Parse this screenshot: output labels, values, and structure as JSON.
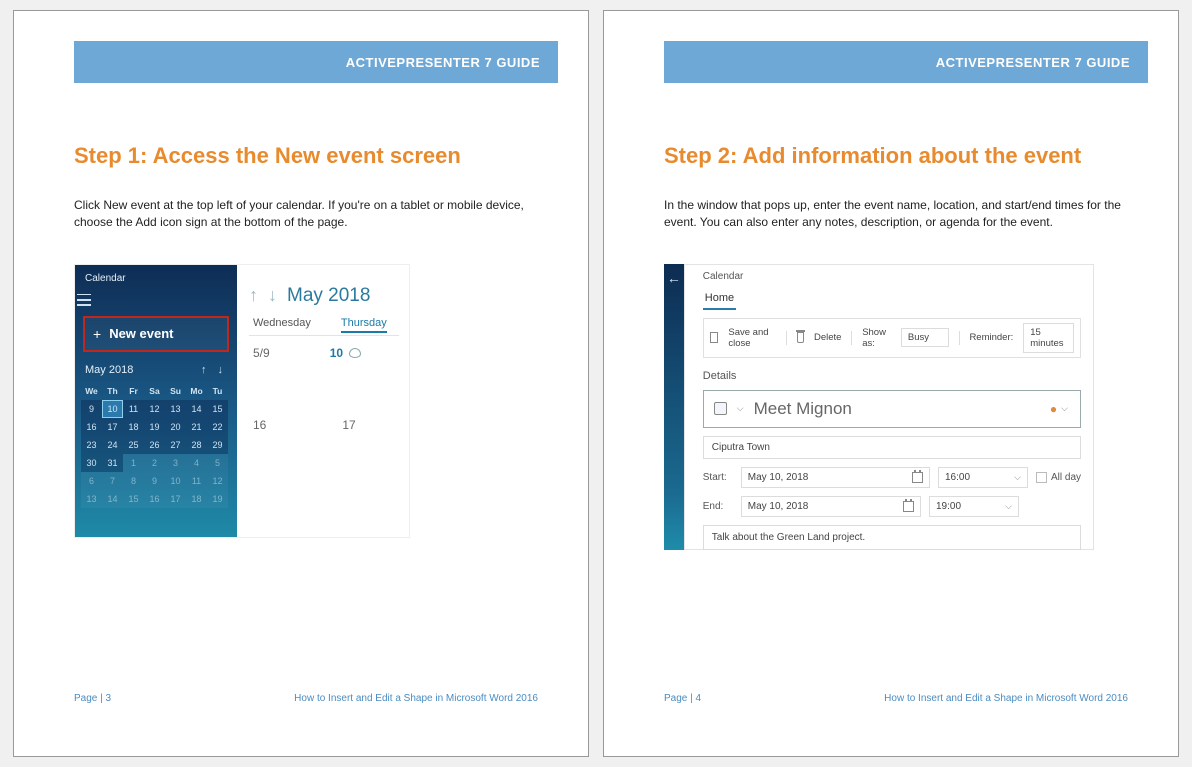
{
  "header_title": "ACTIVEPRESENTER 7 GUIDE",
  "footer_doc_title": "How to Insert and Edit a Shape in Microsoft Word 2016",
  "page1": {
    "number_label": "Page | 3",
    "step_title": "Step 1: Access the New event screen",
    "body": "Click New event at the top left of your calendar. If you're on a tablet or mobile device, choose the  Add icon sign at the bottom of the page.",
    "calendar": {
      "app_label": "Calendar",
      "new_event_label": "New event",
      "mini_month_label": "May 2018",
      "day_headers": [
        "We",
        "Th",
        "Fr",
        "Sa",
        "Su",
        "Mo",
        "Tu"
      ],
      "weeks": [
        [
          "9",
          "10",
          "11",
          "12",
          "13",
          "14",
          "15"
        ],
        [
          "16",
          "17",
          "18",
          "19",
          "20",
          "21",
          "22"
        ],
        [
          "23",
          "24",
          "25",
          "26",
          "27",
          "28",
          "29"
        ],
        [
          "30",
          "31",
          "1",
          "2",
          "3",
          "4",
          "5"
        ],
        [
          "6",
          "7",
          "8",
          "9",
          "10",
          "11",
          "12"
        ],
        [
          "13",
          "14",
          "15",
          "16",
          "17",
          "18",
          "19"
        ]
      ],
      "main_month_label": "May 2018",
      "main_day_labels": [
        "Wednesday",
        "Thursday"
      ],
      "main_dates_top": [
        "5/9",
        "10"
      ],
      "main_dates_bottom": [
        "16",
        "17"
      ]
    }
  },
  "page2": {
    "number_label": "Page | 4",
    "step_title": "Step 2: Add information about the event",
    "body": "In the window that pops up, enter the event name, location, and start/end times for the event. You can also enter any notes, description, or agenda for the event.",
    "form": {
      "app_label": "Calendar",
      "tab": "Home",
      "save_close": "Save and close",
      "delete": "Delete",
      "show_as_label": "Show as:",
      "show_as_value": "Busy",
      "reminder_label": "Reminder:",
      "reminder_value": "15 minutes",
      "details_label": "Details",
      "event_name": "Meet Mignon",
      "location": "Ciputra Town",
      "start_label": "Start:",
      "start_date": "May 10, 2018",
      "start_time": "16:00",
      "end_label": "End:",
      "end_date": "May 10, 2018",
      "end_time": "19:00",
      "all_day_label": "All day",
      "notes": "Talk about the Green Land project."
    }
  }
}
